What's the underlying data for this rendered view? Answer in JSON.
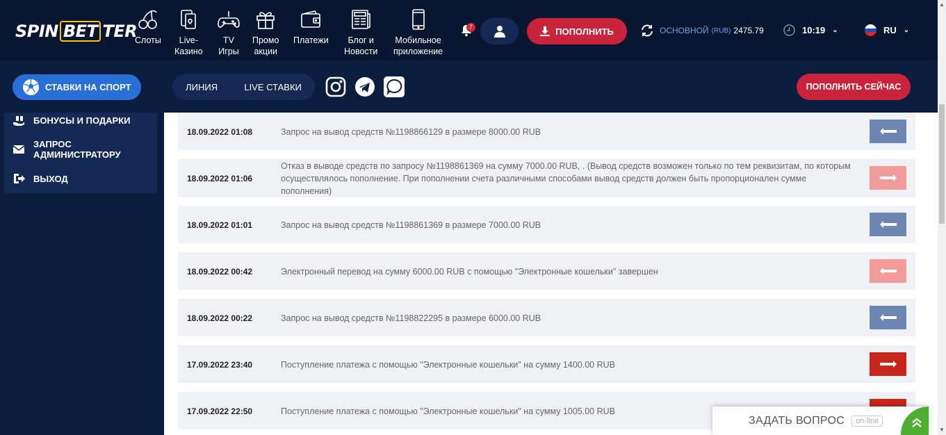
{
  "header": {
    "logo": {
      "part1": "SPIN",
      "part2": "BET",
      "part3": "TER"
    },
    "nav": [
      {
        "label1": "Слоты",
        "label2": "",
        "icon": "cherries-icon"
      },
      {
        "label1": "Live-",
        "label2": "Казино",
        "icon": "cards-icon"
      },
      {
        "label1": "TV",
        "label2": "Игры",
        "icon": "gamepad-icon"
      },
      {
        "label1": "Промо",
        "label2": "акции",
        "icon": "gift-icon"
      },
      {
        "label1": "Платежи",
        "label2": "",
        "icon": "wallet-icon"
      },
      {
        "label1": "Блог и",
        "label2": "Новости",
        "icon": "newspaper-icon"
      },
      {
        "label1": "Мобильное",
        "label2": "приложение",
        "icon": "phone-icon"
      }
    ],
    "notifications_count": "7",
    "deposit_label": "ПОПОЛНИТЬ",
    "balance": {
      "label": "ОСНОВНОЙ",
      "currency": "(RUB)",
      "amount": "2475.79"
    },
    "time": "10:19",
    "language": "RU"
  },
  "subbar": {
    "sport_button": "СТАВКИ НА СПОРТ",
    "tabs": [
      "ЛИНИЯ",
      "LIVE СТАВКИ"
    ],
    "pay_now": "ПОПОЛНИТЬ СЕЙЧАС"
  },
  "sidebar": {
    "items": [
      {
        "label": "БОНУСЫ И ПОДАРКИ"
      },
      {
        "label1": "ЗАПРОС",
        "label2": "АДМИНИСТРАТОРУ"
      },
      {
        "label": "ВЫХОД"
      }
    ]
  },
  "colors": {
    "arrow_blue": "#6d86b3",
    "arrow_pink": "#f29b9b",
    "arrow_red": "#c8261b"
  },
  "transactions": [
    {
      "date": "18.09.2022 01:08",
      "desc": "Запрос на вывод средств №1198866129 в размере 8000.00 RUB",
      "direction": "left",
      "color": "blue"
    },
    {
      "date": "18.09.2022 01:06",
      "desc": "Отказ в выводе средств по запросу №1198861369 на сумму 7000.00 RUB, . (Вывод средств возможен только по тем реквизитам, по которым осуществлялось пополнение. При пополнении счета различными способами вывод средств должен быть пропорционален сумме пополнения)",
      "direction": "right",
      "color": "pink"
    },
    {
      "date": "18.09.2022 01:01",
      "desc": "Запрос на вывод средств №1198861369 в размере 7000.00 RUB",
      "direction": "left",
      "color": "blue"
    },
    {
      "date": "18.09.2022 00:42",
      "desc": "Электронный перевод на сумму 6000.00 RUB с помощью \"Электронные кошельки\" завершен",
      "direction": "left",
      "color": "pink"
    },
    {
      "date": "18.09.2022 00:22",
      "desc": "Запрос на вывод средств №1198822295 в размере 6000.00 RUB",
      "direction": "left",
      "color": "blue"
    },
    {
      "date": "17.09.2022 23:40",
      "desc": "Поступление платежа с помощью \"Электронные кошельки\" на сумму 1400.00 RUB",
      "direction": "right",
      "color": "red"
    },
    {
      "date": "17.09.2022 22:50",
      "desc": "Поступление платежа с помощью \"Электронные кошельки\" на сумму 1005.00 RUB",
      "direction": "right",
      "color": "red"
    }
  ],
  "chat": {
    "question": "ЗАДАТЬ ВОПРОС",
    "status": "on-line"
  }
}
